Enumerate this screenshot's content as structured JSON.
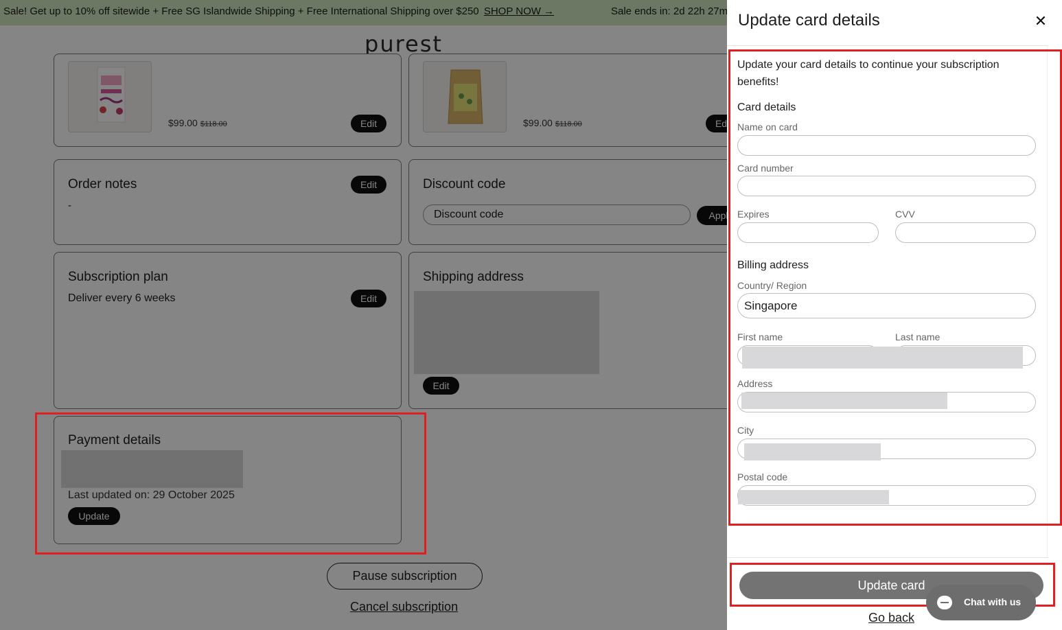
{
  "announcement": {
    "text": "Sale! Get up to 10% off sitewide + Free SG Islandwide Shipping + Free International Shipping over $250",
    "link": "SHOP NOW →",
    "timer": "Sale ends in: 2d 22h 27m"
  },
  "brand": {
    "logo": "purest"
  },
  "products": [
    {
      "price": "$99.00",
      "old_price": "$118.00",
      "edit_label": "Edit"
    },
    {
      "price": "$99.00",
      "old_price": "$118.00",
      "edit_label": "Edit"
    }
  ],
  "order_notes": {
    "title": "Order notes",
    "value": "-",
    "edit_label": "Edit"
  },
  "discount": {
    "title": "Discount code",
    "placeholder": "Discount code",
    "apply_label": "Apply"
  },
  "subscription_plan": {
    "title": "Subscription plan",
    "value": "Deliver every 6 weeks",
    "edit_label": "Edit"
  },
  "shipping_address": {
    "title": "Shipping address",
    "edit_label": "Edit"
  },
  "payment": {
    "title": "Payment details",
    "last_updated": "Last updated on: 29 October 2025",
    "update_label": "Update"
  },
  "actions": {
    "pause_label": "Pause subscription",
    "cancel_label": "Cancel subscription"
  },
  "drawer": {
    "title": "Update card details",
    "close_icon": "close-icon",
    "intro": "Update your card details to continue your subscription benefits!",
    "card_section": "Card details",
    "name_label": "Name on card",
    "number_label": "Card number",
    "expires_label": "Expires",
    "cvv_label": "CVV",
    "billing_section": "Billing address",
    "country_label": "Country/ Region",
    "country_value": "Singapore",
    "first_name_label": "First name",
    "last_name_label": "Last name",
    "address_label": "Address",
    "city_label": "City",
    "postal_label": "Postal code",
    "submit_label": "Update card",
    "back_label": "Go back"
  },
  "chat": {
    "label": "Chat with us"
  },
  "colors": {
    "highlight": "#e02020",
    "announcement_bg": "#cfe7bf",
    "submit_bg": "#737373"
  }
}
